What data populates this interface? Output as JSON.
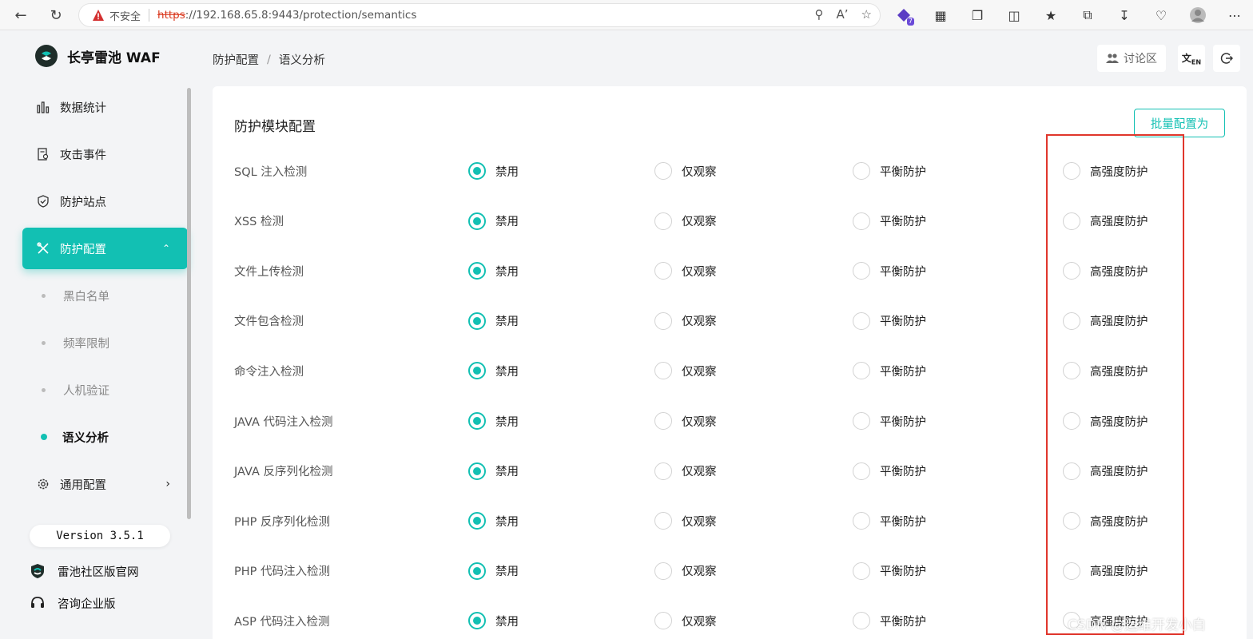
{
  "browser": {
    "insecure_label": "不安全",
    "url_scheme": "https",
    "url_rest": "://192.168.65.8:9443/protection/semantics",
    "ext_badge": "7"
  },
  "app": {
    "name": "长亭雷池 WAF",
    "accent_color": "#12c0b3"
  },
  "sidebar": {
    "items": [
      {
        "label": "数据统计",
        "icon": "bar-chart-icon"
      },
      {
        "label": "攻击事件",
        "icon": "document-search-icon"
      },
      {
        "label": "防护站点",
        "icon": "shield-icon"
      },
      {
        "label": "防护配置",
        "icon": "tools-icon"
      }
    ],
    "subitems": [
      {
        "label": "黑白名单"
      },
      {
        "label": "频率限制"
      },
      {
        "label": "人机验证"
      },
      {
        "label": "语义分析"
      }
    ],
    "general": {
      "label": "通用配置",
      "icon": "gear-icon"
    },
    "version": "Version 3.5.1",
    "community_link": "雷池社区版官网",
    "enterprise_link": "咨询企业版"
  },
  "header": {
    "breadcrumb": [
      "防护配置",
      "语义分析"
    ],
    "breadcrumb_sep": "/",
    "discuss_label": "讨论区"
  },
  "main": {
    "title": "防护模块配置",
    "batch_button": "批量配置为",
    "options": [
      "禁用",
      "仅观察",
      "平衡防护",
      "高强度防护"
    ],
    "rows": [
      {
        "name": "SQL 注入检测",
        "selected": "禁用"
      },
      {
        "name": "XSS 检测",
        "selected": "禁用"
      },
      {
        "name": "文件上传检测",
        "selected": "禁用"
      },
      {
        "name": "文件包含检测",
        "selected": "禁用"
      },
      {
        "name": "命令注入检测",
        "selected": "禁用"
      },
      {
        "name": "JAVA 代码注入检测",
        "selected": "禁用"
      },
      {
        "name": "JAVA 反序列化检测",
        "selected": "禁用"
      },
      {
        "name": "PHP 反序列化检测",
        "selected": "禁用"
      },
      {
        "name": "PHP 代码注入检测",
        "selected": "禁用"
      },
      {
        "name": "ASP 代码注入检测",
        "selected": "禁用"
      }
    ]
  },
  "watermark": "CSDN @运维开发小白"
}
